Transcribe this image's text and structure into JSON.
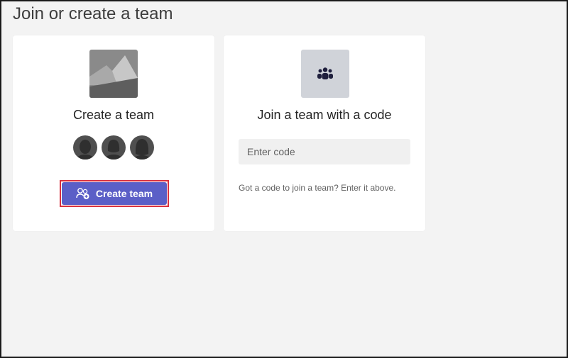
{
  "page": {
    "title": "Join or create a team"
  },
  "create_card": {
    "title": "Create a team",
    "button_label": "Create team",
    "image_icon": "landscape-image-icon",
    "button_icon": "add-people-icon",
    "avatar_count": 3
  },
  "join_card": {
    "title": "Join a team with a code",
    "icon": "teams-people-icon",
    "input_placeholder": "Enter code",
    "input_value": "",
    "hint": "Got a code to join a team? Enter it above."
  },
  "colors": {
    "accent": "#5b5fc7",
    "highlight_border": "#d9303f",
    "background": "#f3f3f3",
    "card": "#ffffff"
  }
}
